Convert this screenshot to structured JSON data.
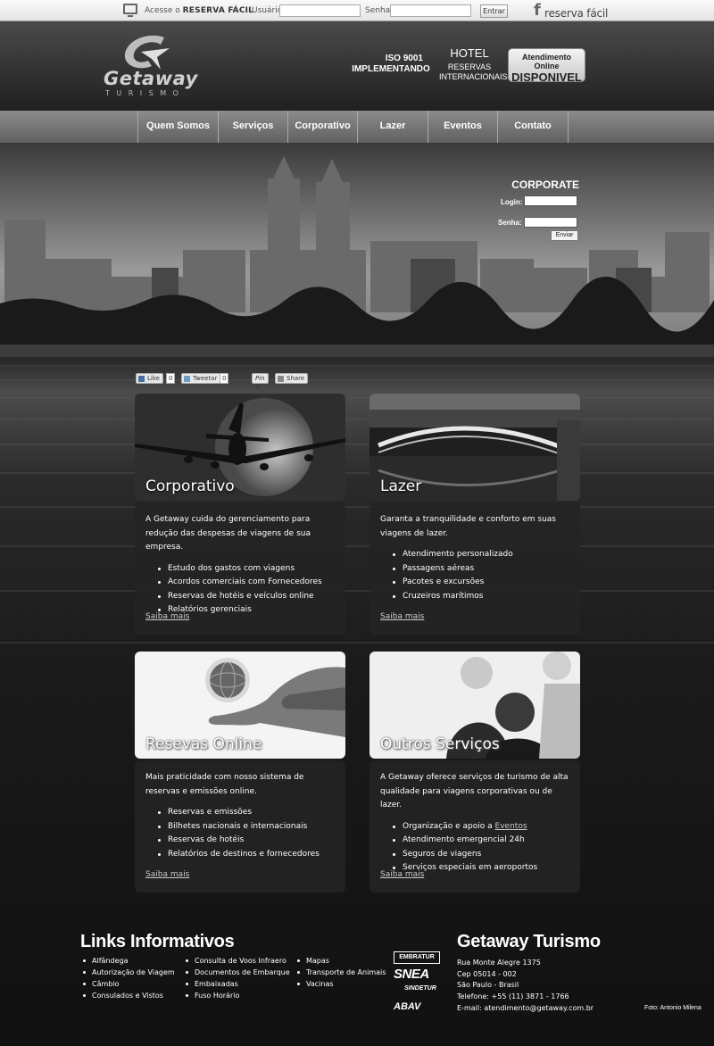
{
  "topbar": {
    "access_prefix": "Acesse o",
    "access_brand": "RESERVA FÁCIL",
    "user_label": "Usuário:",
    "password_label": "Senha:",
    "submit": "Entrar",
    "brand_logo": "reserva fácil"
  },
  "header": {
    "logo_word": "Getaway",
    "logo_sub": "TURISMO",
    "iso_1": "ISO 9001",
    "iso_2": "IMPLEMENTANDO",
    "hotel_1": "HOTEL",
    "hotel_2": "RESERVAS",
    "hotel_3": "INTERNACIONAIS",
    "online_1": "Atendimento Online",
    "online_2": "DISPONIVEL"
  },
  "nav": {
    "items": [
      {
        "label": "Quem Somos"
      },
      {
        "label": "Serviços"
      },
      {
        "label": "Corporativo"
      },
      {
        "label": "Lazer"
      },
      {
        "label": "Eventos"
      },
      {
        "label": "Contato"
      }
    ]
  },
  "corporate": {
    "title": "CORPORATE",
    "login_label": "Login:",
    "password_label": "Senha:",
    "submit": "Enviar"
  },
  "social": {
    "like": "Like",
    "like_count": "0",
    "tweet": "Tweetar",
    "tweet_count": "0",
    "pin": "Pin it",
    "share": "Share"
  },
  "cards": [
    {
      "title": "Corporativo",
      "intro": "A Getaway cuida do gerenciamento para redução das despesas de viagens de sua empresa.",
      "items": [
        "Estudo dos gastos com viagens",
        "Acordos comerciais com Fornecedores",
        "Reservas de hotéis e veículos online",
        "Relatórios gerenciais"
      ],
      "more": "Saiba mais"
    },
    {
      "title": "Lazer",
      "intro": "Garanta a tranquilidade e conforto em suas viagens de lazer.",
      "items": [
        "Atendimento personalizado",
        "Passagens aéreas",
        "Pacotes e excursões",
        "Cruzeiros marítimos"
      ],
      "more": "Saiba mais"
    },
    {
      "title": "Resevas Online",
      "intro": "Mais praticidade com nosso sistema de reservas e emissões online.",
      "items": [
        "Reservas e emissões",
        "Bilhetes nacionais e internacionais",
        "Reservas de hotéis",
        "Relatórios de destinos e fornecedores"
      ],
      "more": "Saiba mais"
    },
    {
      "title": "Outros Serviços",
      "intro": "A Getaway oferece serviços de turismo de alta qualidade para viagens corporativas ou de lazer.",
      "items_first_prefix": "Organização e apoio a",
      "items_first_link": "Eventos",
      "items": [
        "Atendimento emergencial 24h",
        "Seguros de viagens",
        "Serviços especiais em aeroportos"
      ],
      "more": "Saiba mais"
    }
  ],
  "footer": {
    "links_title": "Links Informativos",
    "col1": [
      "Alfândega",
      "Autorização de Viagem",
      "Câmbio",
      "Consulados e Vistos"
    ],
    "col2": [
      "Consulta de Voos Infraero",
      "Documentos de Embarque",
      "Embaixadas",
      "Fuso Horário"
    ],
    "col3": [
      "Mapas",
      "Transporte de Animais",
      "Vacinas"
    ],
    "assoc": [
      "EMBRATUR",
      "SNEA",
      "SINDETUR",
      "ABAV"
    ],
    "company_name": "Getaway Turismo",
    "address_1": "Rua Monte Alegre 1375",
    "address_2": "Cep 05014 - 002",
    "address_3": "São Paulo - Brasil",
    "phone": "Telefone: +55 (11) 3871 - 1766",
    "email": "E-mail: atendimento@getaway.com.br",
    "photo_credit": "Foto: Antonio Milena"
  }
}
